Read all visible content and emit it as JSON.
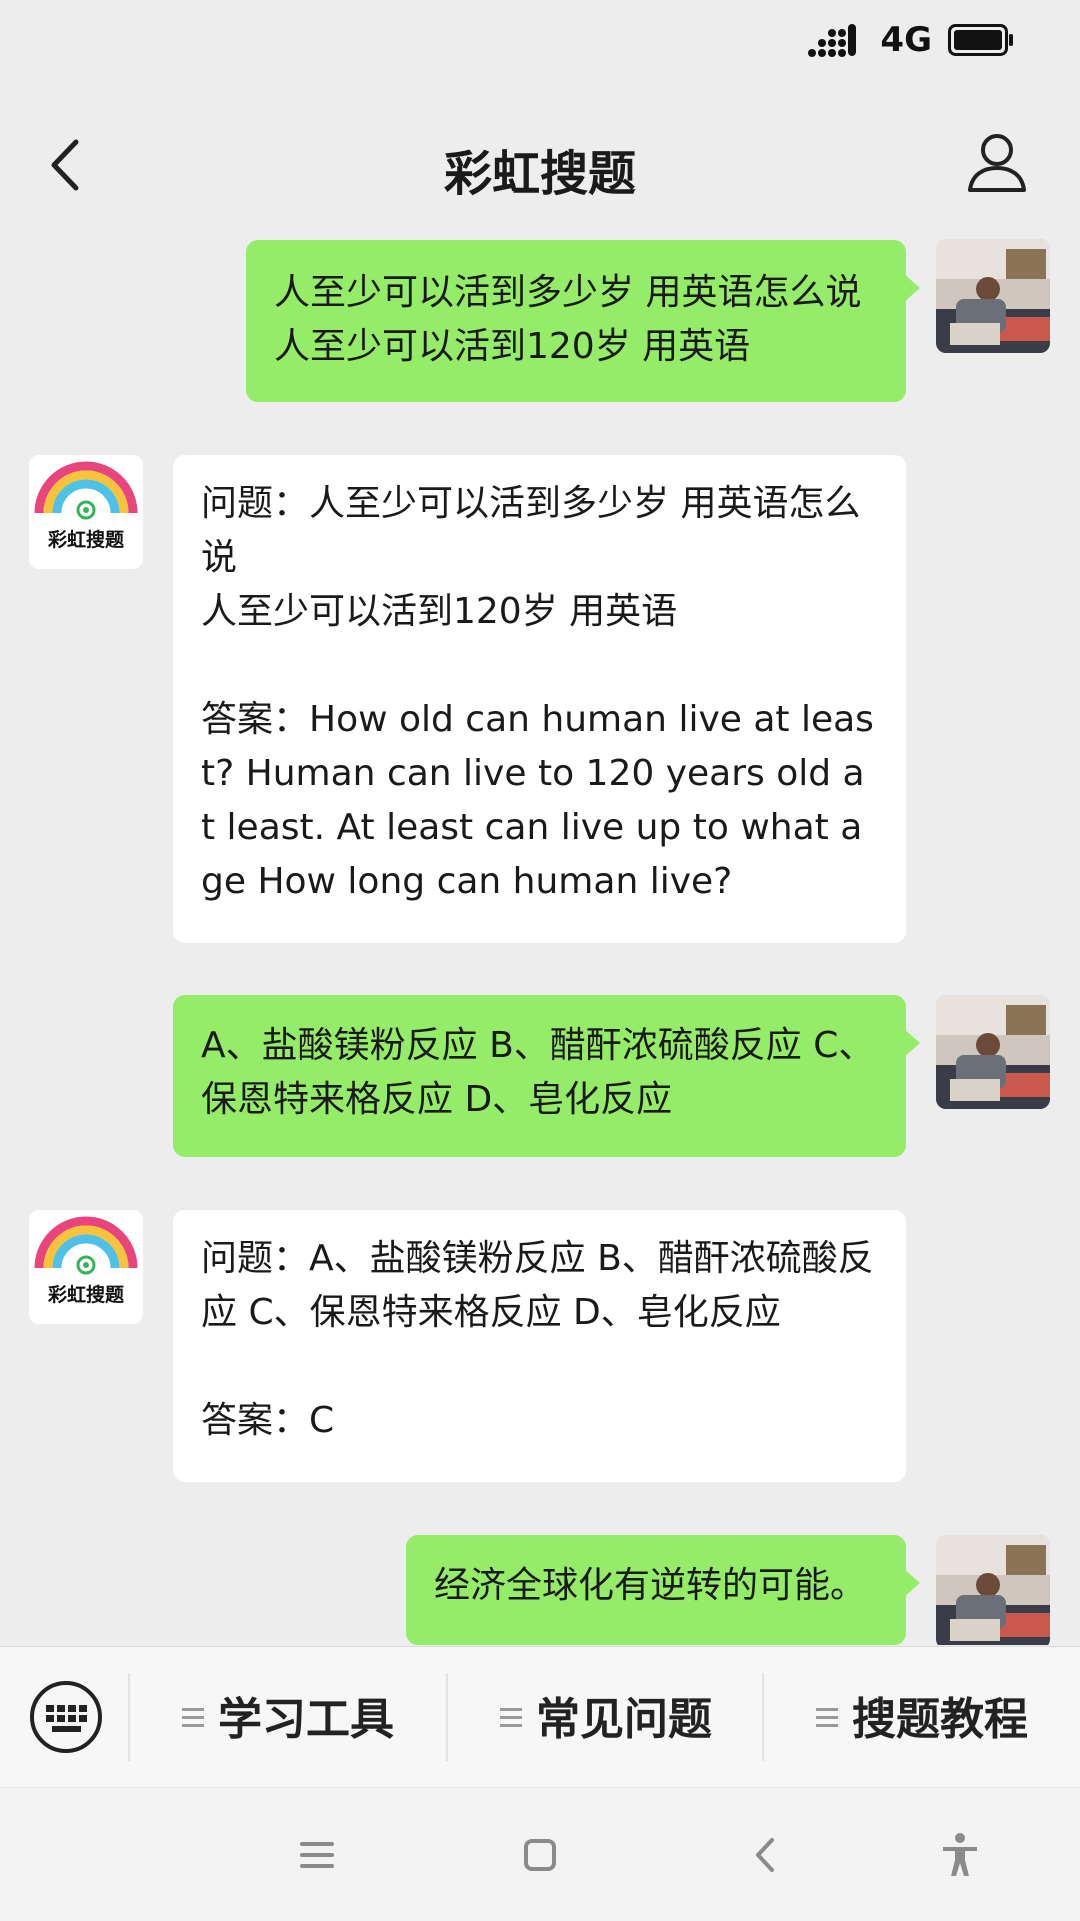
{
  "status_bar": {
    "network": "4G",
    "icons": [
      "signal-icon",
      "battery-icon"
    ]
  },
  "header": {
    "title": "彩虹搜题",
    "back_icon": "chevron-left-icon",
    "profile_icon": "person-icon"
  },
  "messages": [
    {
      "from": "user",
      "text": "人至少可以活到多少岁 用英语怎么说\n人至少可以活到120岁 用英语"
    },
    {
      "from": "bot",
      "logo_text": "彩虹搜题",
      "text": "问题：人至少可以活到多少岁 用英语怎么说\n人至少可以活到120岁 用英语\n\n答案：How old can human live at least? Human can live to 120 years old at least. At least can live up to what age How long can human live?"
    },
    {
      "from": "user",
      "text": "A、盐酸镁粉反应 B、醋酐浓硫酸反应 C、保恩特来格反应 D、皂化反应"
    },
    {
      "from": "bot",
      "logo_text": "彩虹搜题",
      "text": "问题：A、盐酸镁粉反应 B、醋酐浓硫酸反应 C、保恩特来格反应 D、皂化反应\n\n答案：C"
    },
    {
      "from": "user",
      "text": "经济全球化有逆转的可能。"
    }
  ],
  "menu": {
    "keyboard_icon": "keyboard-icon",
    "items": [
      {
        "label": "学习工具"
      },
      {
        "label": "常见问题"
      },
      {
        "label": "搜题教程"
      }
    ]
  },
  "nav": {
    "icons": [
      "menu-icon",
      "home-square-icon",
      "back-arrow-icon",
      "accessibility-icon"
    ]
  },
  "colors": {
    "user_bubble": "#95ec69",
    "bot_bubble": "#ffffff",
    "background": "#ededed"
  }
}
